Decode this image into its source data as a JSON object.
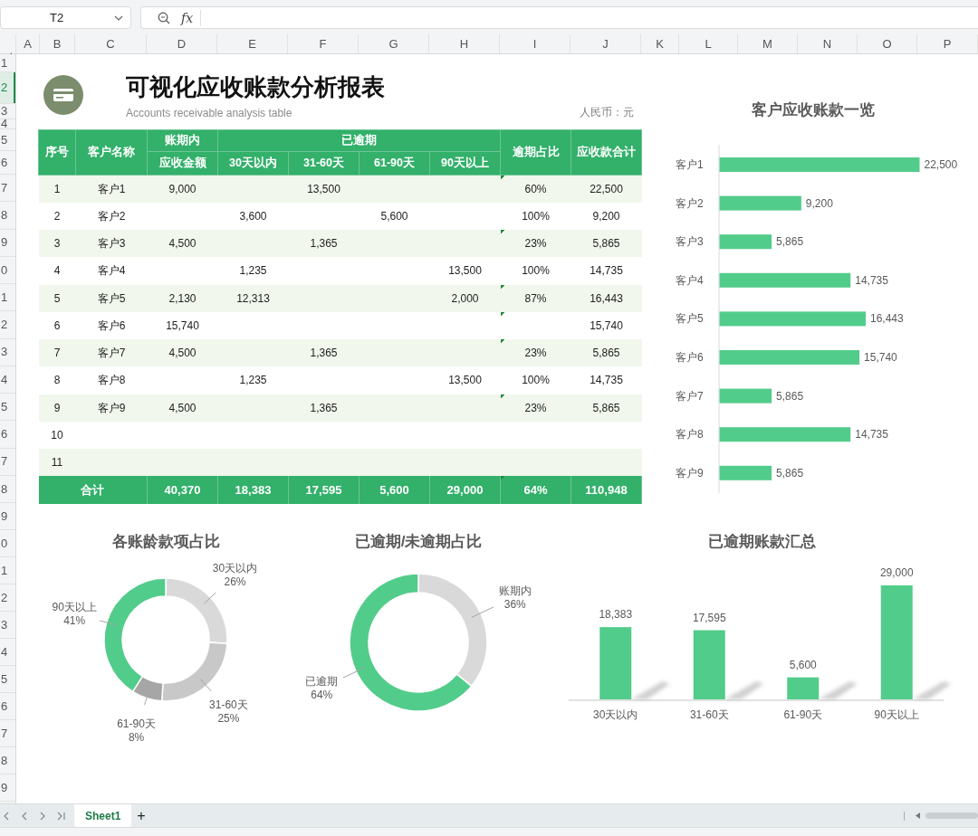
{
  "name_box": {
    "value": "T2"
  },
  "formula_bar": {
    "function_label": "fx"
  },
  "column_headers": [
    "A",
    "B",
    "C",
    "D",
    "E",
    "F",
    "G",
    "H",
    "I",
    "J",
    "K",
    "L",
    "M",
    "N",
    "O",
    "P"
  ],
  "row_headers": [
    {
      "label": "1",
      "selected": false
    },
    {
      "label": "2",
      "selected": true
    },
    {
      "label": "3",
      "selected": false
    },
    {
      "label": "4",
      "selected": false
    },
    {
      "label": "5",
      "selected": false
    },
    {
      "label": "6",
      "selected": false
    },
    {
      "label": "7",
      "selected": false
    },
    {
      "label": "8",
      "selected": false
    },
    {
      "label": "9",
      "selected": false
    },
    {
      "label": "0",
      "selected": false
    },
    {
      "label": "1",
      "selected": false
    },
    {
      "label": "2",
      "selected": false
    },
    {
      "label": "3",
      "selected": false
    },
    {
      "label": "4",
      "selected": false
    },
    {
      "label": "5",
      "selected": false
    },
    {
      "label": "6",
      "selected": false
    },
    {
      "label": "7",
      "selected": false
    },
    {
      "label": "8",
      "selected": false
    },
    {
      "label": "9",
      "selected": false
    },
    {
      "label": "0",
      "selected": false
    },
    {
      "label": "1",
      "selected": false
    },
    {
      "label": "2",
      "selected": false
    },
    {
      "label": "3",
      "selected": false
    },
    {
      "label": "4",
      "selected": false
    },
    {
      "label": "5",
      "selected": false
    },
    {
      "label": "6",
      "selected": false
    },
    {
      "label": "7",
      "selected": false
    },
    {
      "label": "8",
      "selected": false
    },
    {
      "label": "9",
      "selected": false
    }
  ],
  "report": {
    "title": "可视化应收账款分析报表",
    "subtitle": "Accounts receivable analysis table",
    "currency_note": "人民币：元",
    "table": {
      "header_rows": [
        [
          {
            "text": "序号",
            "rowspan": 2
          },
          {
            "text": "客户名称",
            "rowspan": 2
          },
          {
            "text": "账期内"
          },
          {
            "text": "已逾期",
            "colspan": 4
          },
          {
            "text": "逾期占比",
            "rowspan": 2
          },
          {
            "text": "应收款合计",
            "rowspan": 2
          }
        ],
        [
          {
            "text": "应收金额"
          },
          {
            "text": "30天以内"
          },
          {
            "text": "31-60天"
          },
          {
            "text": "61-90天"
          },
          {
            "text": "90天以上"
          }
        ]
      ],
      "rows": [
        {
          "cells": [
            "1",
            "客户1",
            "9,000",
            null,
            "13,500",
            null,
            null,
            "60%",
            "22,500"
          ],
          "flagged": true
        },
        {
          "cells": [
            "2",
            "客户2",
            null,
            "3,600",
            null,
            "5,600",
            null,
            "100%",
            "9,200"
          ],
          "flagged": false
        },
        {
          "cells": [
            "3",
            "客户3",
            "4,500",
            null,
            "1,365",
            null,
            null,
            "23%",
            "5,865"
          ],
          "flagged": true
        },
        {
          "cells": [
            "4",
            "客户4",
            null,
            "1,235",
            null,
            null,
            "13,500",
            "100%",
            "14,735"
          ],
          "flagged": false
        },
        {
          "cells": [
            "5",
            "客户5",
            "2,130",
            "12,313",
            null,
            null,
            "2,000",
            "87%",
            "16,443"
          ],
          "flagged": true
        },
        {
          "cells": [
            "6",
            "客户6",
            "15,740",
            null,
            null,
            null,
            null,
            null,
            "15,740"
          ],
          "flagged": true
        },
        {
          "cells": [
            "7",
            "客户7",
            "4,500",
            null,
            "1,365",
            null,
            null,
            "23%",
            "5,865"
          ],
          "flagged": true
        },
        {
          "cells": [
            "8",
            "客户8",
            null,
            "1,235",
            null,
            null,
            "13,500",
            "100%",
            "14,735"
          ],
          "flagged": false
        },
        {
          "cells": [
            "9",
            "客户9",
            "4,500",
            null,
            "1,365",
            null,
            null,
            "23%",
            "5,865"
          ],
          "flagged": true
        },
        {
          "cells": [
            "10",
            null,
            null,
            null,
            null,
            null,
            null,
            null,
            null
          ],
          "flagged": false
        },
        {
          "cells": [
            "11",
            null,
            null,
            null,
            null,
            null,
            null,
            null,
            null
          ],
          "flagged": false
        }
      ],
      "total": {
        "label": "合计",
        "cells": [
          "40,370",
          "18,383",
          "17,595",
          "5,600",
          "29,000",
          "64%",
          "110,948"
        ],
        "flagged": true
      }
    }
  },
  "customer_chart": {
    "chart_data": {
      "type": "bar",
      "orientation": "horizontal",
      "title": "客户应收账款一览",
      "categories": [
        "客户1",
        "客户2",
        "客户3",
        "客户4",
        "客户5",
        "客户6",
        "客户7",
        "客户8",
        "客户9"
      ],
      "series": [
        {
          "color": "#52cc8a",
          "values": [
            22500,
            9200,
            5865,
            14735,
            16443,
            15740,
            5865,
            14735,
            5865
          ],
          "value_labels": [
            "22,500",
            "9,200",
            "5,865",
            "14,735",
            "16,443",
            "15,740",
            "5,865",
            "14,735",
            "5,865"
          ]
        }
      ]
    }
  },
  "aging_chart": {
    "chart_data": {
      "type": "donut",
      "title": "各账龄款项占比",
      "categories": [
        "30天以内",
        "31-60天",
        "61-90天",
        "90天以上"
      ],
      "values": [
        26,
        25,
        8,
        41
      ],
      "colors": [
        "#d9d9d9",
        "#c8c8c8",
        "#a6a6a6",
        "#52cc8a"
      ],
      "value_labels": [
        "26%",
        "25%",
        "8%",
        "41%"
      ]
    }
  },
  "overdue_ratio_chart": {
    "chart_data": {
      "type": "donut",
      "title": "已逾期/未逾期占比",
      "categories": [
        "账期内",
        "已逾期"
      ],
      "values": [
        36,
        64
      ],
      "colors": [
        "#d9d9d9",
        "#52cc8a"
      ],
      "value_labels": [
        "36%",
        "64%"
      ]
    }
  },
  "overdue_summary_chart": {
    "chart_data": {
      "type": "bar",
      "orientation": "vertical",
      "title": "已逾期账款汇总",
      "categories": [
        "30天以内",
        "31-60天",
        "61-90天",
        "90天以上"
      ],
      "series": [
        {
          "color": "#52cc8a",
          "values": [
            18383,
            17595,
            5600,
            29000
          ],
          "value_labels": [
            "18,383",
            "17,595",
            "5,600",
            "29,000"
          ]
        }
      ]
    }
  },
  "sheet_tabs": [
    {
      "label": "Sheet1",
      "selected": true
    }
  ],
  "add_sheet_label": "+"
}
